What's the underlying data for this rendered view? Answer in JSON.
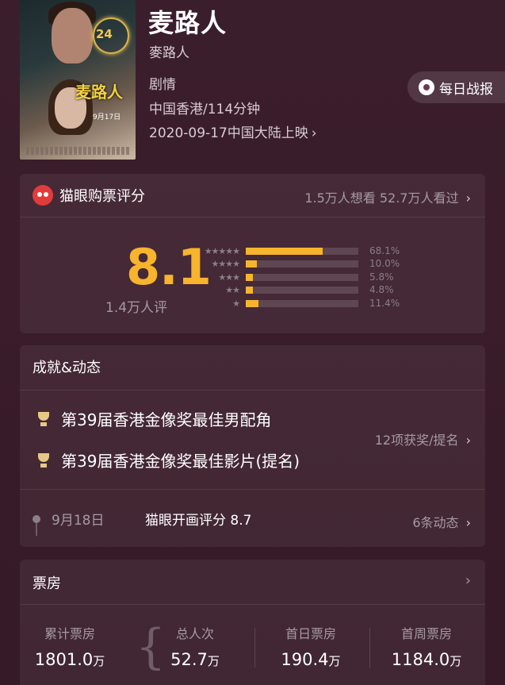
{
  "movie": {
    "title": "麦路人",
    "original_title": "麥路人",
    "genre": "剧情",
    "region_duration": "中国香港/114分钟",
    "release": "2020-09-17中国大陆上映",
    "poster": {
      "neon_text": "24",
      "title": "麦路人",
      "date": "9月17日"
    }
  },
  "daily_report": {
    "label": "每日战报",
    "icon": "medal-icon"
  },
  "rating": {
    "header": "猫眼购票评分",
    "stats": "1.5万人想看 52.7万人看过",
    "score": "8.1",
    "count": "1.4万人评",
    "distribution": [
      {
        "stars": "★★★★★",
        "percent": "68.1%",
        "fraction": 0.681
      },
      {
        "stars": "★★★★",
        "percent": "10.0%",
        "fraction": 0.1
      },
      {
        "stars": "★★★",
        "percent": "5.8%",
        "fraction": 0.058
      },
      {
        "stars": "★★",
        "percent": "4.8%",
        "fraction": 0.048
      },
      {
        "stars": "★",
        "percent": "11.4%",
        "fraction": 0.114
      }
    ],
    "colors": {
      "accent": "#f7b42c",
      "brand": "#e23b3b"
    }
  },
  "awards": {
    "header": "成就&动态",
    "items": [
      "第39届香港金像奖最佳男配角",
      "第39届香港金像奖最佳影片(提名)"
    ],
    "summary": "12项获奖/提名",
    "timeline": {
      "date": "9月18日",
      "text": "猫眼开画评分 8.7",
      "more": "6条动态"
    }
  },
  "box_office": {
    "header": "票房",
    "stats": [
      {
        "label": "累计票房",
        "value": "1801.0",
        "unit": "万"
      },
      {
        "label": "总人次",
        "value": "52.7",
        "unit": "万"
      },
      {
        "label": "首日票房",
        "value": "190.4",
        "unit": "万"
      },
      {
        "label": "首周票房",
        "value": "1184.0",
        "unit": "万"
      }
    ]
  }
}
